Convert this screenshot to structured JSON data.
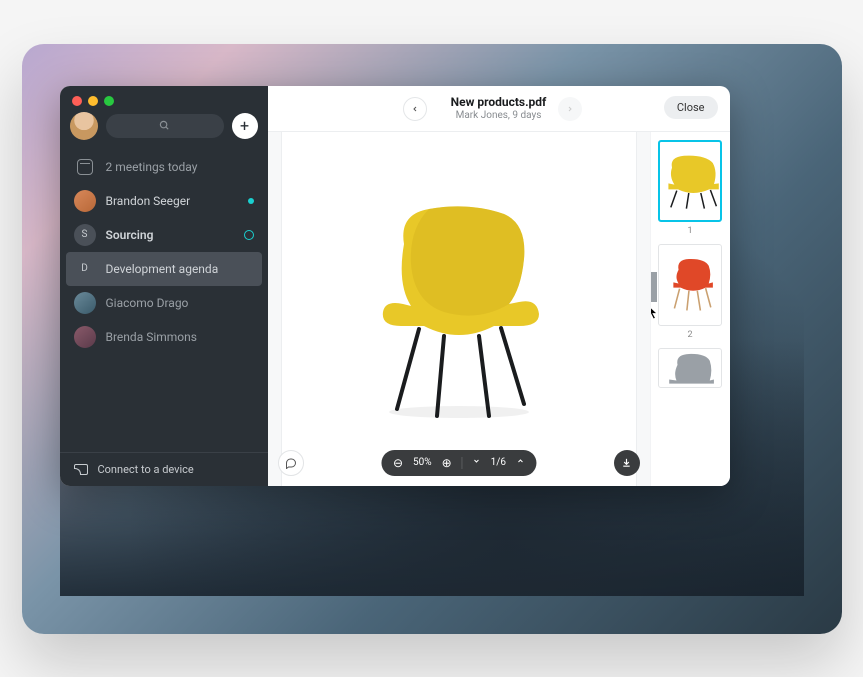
{
  "sidebar": {
    "meetings": "2 meetings today",
    "items": [
      {
        "label": "Brandon Seeger",
        "badge": "dot"
      },
      {
        "label": "Sourcing",
        "badge": "ring",
        "initial": "S"
      },
      {
        "label": "Development agenda",
        "initial": "D",
        "selected": true
      },
      {
        "label": "Giacomo Drago"
      },
      {
        "label": "Brenda Simmons"
      }
    ],
    "connect": "Connect to a device"
  },
  "header": {
    "title": "New products.pdf",
    "subtitle": "Mark Jones, 9 days",
    "close": "Close"
  },
  "viewer": {
    "zoom": "50%",
    "page": "1/6"
  },
  "thumbs": {
    "labels": [
      "1",
      "2"
    ]
  },
  "colors": {
    "accent": "#08c4e8",
    "chair_yellow": "#e8c828",
    "chair_red": "#e04828",
    "chair_gray": "#9aa0a6"
  }
}
